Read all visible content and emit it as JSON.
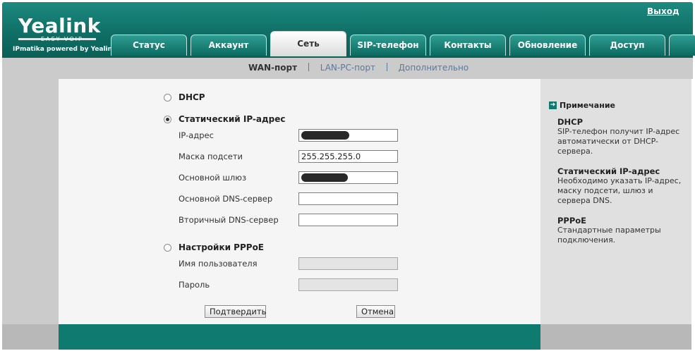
{
  "header": {
    "brand": "Yealink",
    "brand_sub": "EASY VOIP",
    "powered": "IPmatika powered by Yealink",
    "logout": "Выход"
  },
  "tabs": [
    {
      "label": "Статус"
    },
    {
      "label": "Аккаунт"
    },
    {
      "label": "Сеть"
    },
    {
      "label": "SIP-телефон"
    },
    {
      "label": "Контакты"
    },
    {
      "label": "Обновление"
    },
    {
      "label": "Доступ"
    }
  ],
  "active_tab": "Сеть",
  "subnav": {
    "active": "WAN-порт",
    "items": [
      "LAN-PC-порт",
      "Дополнительно"
    ]
  },
  "form": {
    "dhcp_label": "DHCP",
    "static_label": "Статический IP-адрес",
    "selected_mode": "static",
    "static_fields": [
      {
        "label": "IP-адрес",
        "value": "",
        "redacted": true
      },
      {
        "label": "Маска подсети",
        "value": "255.255.255.0",
        "redacted": false
      },
      {
        "label": "Основной шлюз",
        "value": "",
        "redacted": true
      },
      {
        "label": "Основной DNS-сервер",
        "value": "",
        "redacted": false
      },
      {
        "label": "Вторичный DNS-сервер",
        "value": "",
        "redacted": false
      }
    ],
    "pppoe_label": "Настройки PPPoE",
    "pppoe_fields": [
      {
        "label": "Имя пользователя",
        "value": ""
      },
      {
        "label": "Пароль",
        "value": ""
      }
    ],
    "confirm_label": "Подтвердить",
    "cancel_label": "Отмена"
  },
  "note": {
    "title": "Примечание",
    "sections": [
      {
        "head": "DHCP",
        "text": "SIP-телефон получит IP-адрес автоматически от DHCP-сервера."
      },
      {
        "head": "Статический IP-адрес",
        "text": "Необходимо указать IP-адрес, маску подсети, шлюз и сервера DNS."
      },
      {
        "head": "PPPoE",
        "text": "Стандартные параметры подключения."
      }
    ]
  },
  "colors": {
    "teal": "#0f7a70",
    "gray": "#cbcbcb",
    "link": "#5a7aa0"
  }
}
